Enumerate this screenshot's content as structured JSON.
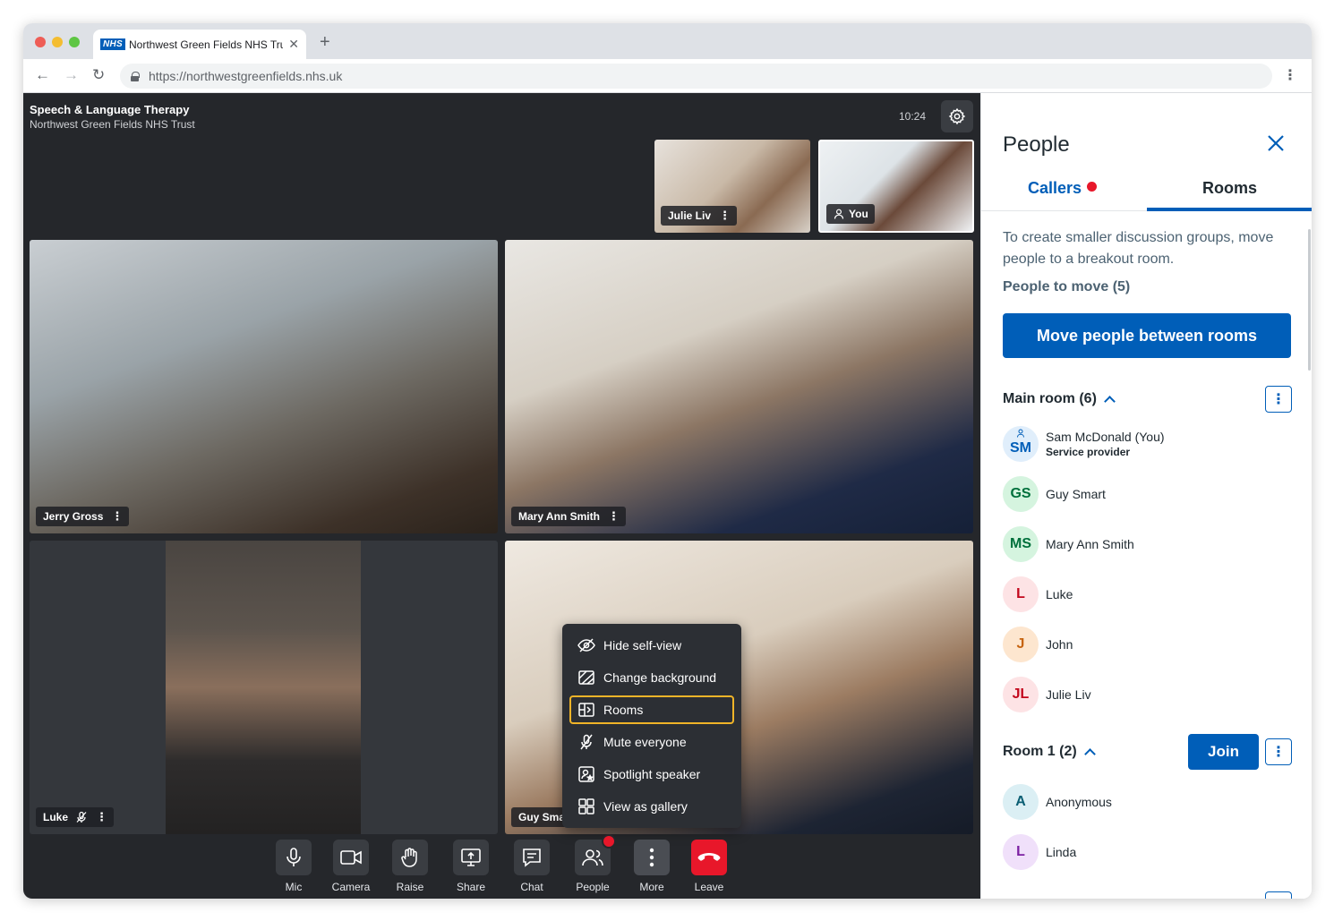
{
  "browser": {
    "tab_logo": "NHS",
    "tab_title": "Northwest Green Fields NHS Trust",
    "url": "https://northwestgreenfields.nhs.uk"
  },
  "call": {
    "title": "Speech & Language Therapy",
    "subtitle": "Northwest Green Fields NHS Trust",
    "time": "10:24",
    "thumbnails": [
      {
        "name": "Julie Liv"
      },
      {
        "name": "You"
      }
    ],
    "tiles": [
      {
        "name": "Jerry Gross"
      },
      {
        "name": "Mary Ann Smith"
      },
      {
        "name": "Luke"
      },
      {
        "name": "Guy Sma"
      }
    ]
  },
  "toolbar": {
    "mic": "Mic",
    "camera": "Camera",
    "raise": "Raise",
    "share": "Share",
    "chat": "Chat",
    "people": "People",
    "more": "More",
    "leave": "Leave"
  },
  "more_menu": {
    "items": [
      {
        "label": "Hide self-view",
        "icon": "eye-off-icon"
      },
      {
        "label": "Change background",
        "icon": "background-icon"
      },
      {
        "label": "Rooms",
        "icon": "rooms-icon",
        "focused": true
      },
      {
        "label": "Mute everyone",
        "icon": "mic-off-icon"
      },
      {
        "label": "Spotlight speaker",
        "icon": "spotlight-icon"
      },
      {
        "label": "View as gallery",
        "icon": "gallery-icon"
      }
    ]
  },
  "panel": {
    "title": "People",
    "tabs": {
      "callers": "Callers",
      "rooms": "Rooms"
    },
    "description": "To create smaller discussion groups, move people to a breakout room.",
    "people_to_move": "People to move (5)",
    "move_button": "Move people between rooms",
    "main_room": {
      "title": "Main room (6)",
      "people": [
        {
          "initials": "SM",
          "name": "Sam McDonald (You)",
          "role": "Service provider"
        },
        {
          "initials": "GS",
          "name": "Guy Smart"
        },
        {
          "initials": "MS",
          "name": "Mary Ann Smith"
        },
        {
          "initials": "L",
          "name": "Luke"
        },
        {
          "initials": "J",
          "name": "John"
        },
        {
          "initials": "JL",
          "name": "Julie Liv"
        }
      ]
    },
    "room1": {
      "title": "Room 1 (2)",
      "join": "Join",
      "people": [
        {
          "initials": "A",
          "name": "Anonymous"
        },
        {
          "initials": "L",
          "name": "Linda"
        }
      ]
    }
  },
  "colors": {
    "nhs_blue": "#005eb8",
    "leave_red": "#e8172a",
    "focus_yellow": "#f0b428",
    "call_background": "#25272b"
  }
}
